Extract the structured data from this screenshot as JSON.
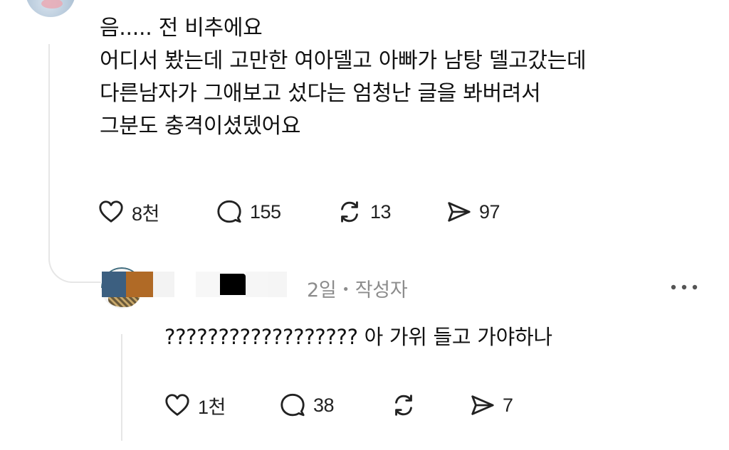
{
  "post": {
    "lines": [
      "음..... 전 비추에요",
      "어디서 봤는데 고만한 여아델고 아빠가 남탕 델고갔는데",
      "다른남자가 그애보고 섰다는 엄청난 글을 봐버려서",
      "그분도 충격이셨뎄어요"
    ],
    "actions": {
      "like_count": "8천",
      "comment_count": "155",
      "repost_count": "13",
      "share_count": "97"
    }
  },
  "reply": {
    "time": "2일",
    "separator": "•",
    "author_tag": "작성자",
    "text": "?????????????????? 아 가위 들고 가야하나",
    "actions": {
      "like_count": "1천",
      "comment_count": "38",
      "repost_count": "",
      "share_count": "7"
    }
  },
  "icons": {
    "like": "heart-icon",
    "comment": "speech-bubble-icon",
    "repost": "repost-icon",
    "share": "send-icon",
    "more": "more-dots-icon"
  },
  "colors": {
    "text": "#111111",
    "meta": "#8c8c8c",
    "thread_line": "#e6e6e6",
    "icon_stroke": "#222222"
  }
}
